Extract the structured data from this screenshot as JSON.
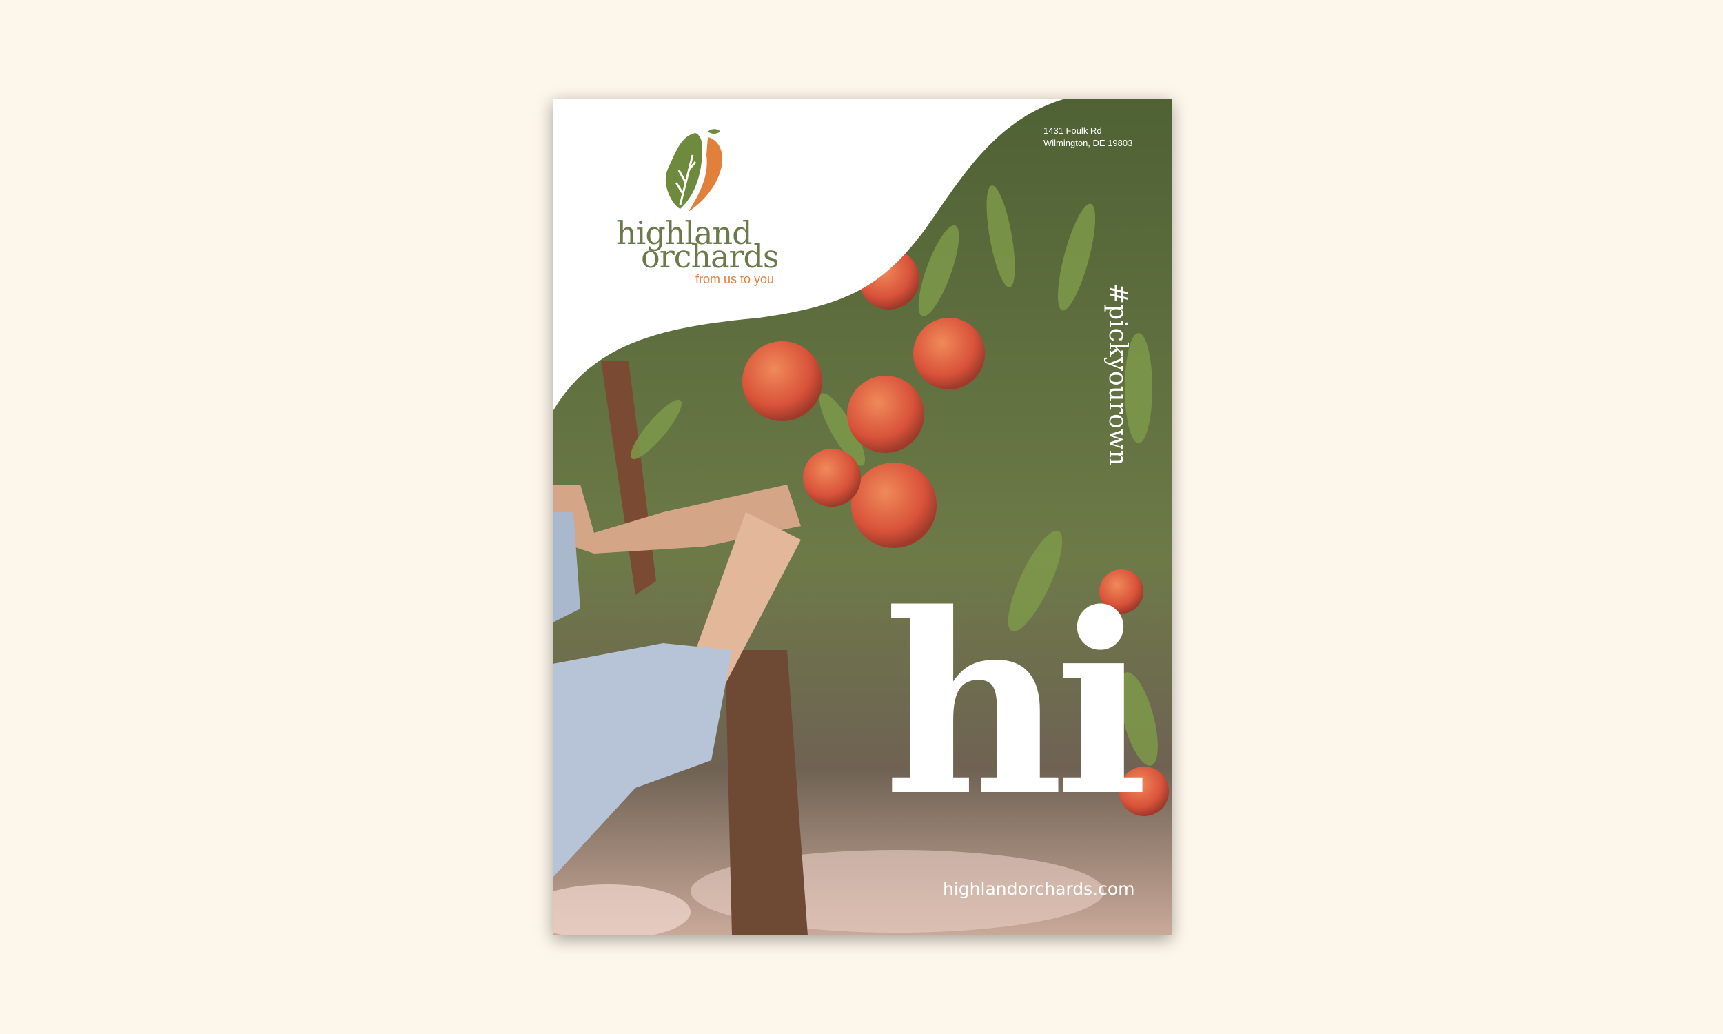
{
  "poster": {
    "brand_line1": "highland",
    "brand_line2": "orchards",
    "tagline": "from us to you",
    "address_line1": "1431 Foulk Rd",
    "address_line2": "Wilmington, DE 19803",
    "hashtag": "#pickyourown",
    "headline": "hi",
    "website": "highlandorchards.com"
  },
  "colors": {
    "background": "#fdf6ea",
    "brand_green": "#6b7a4b",
    "brand_orange": "#e0803a"
  }
}
